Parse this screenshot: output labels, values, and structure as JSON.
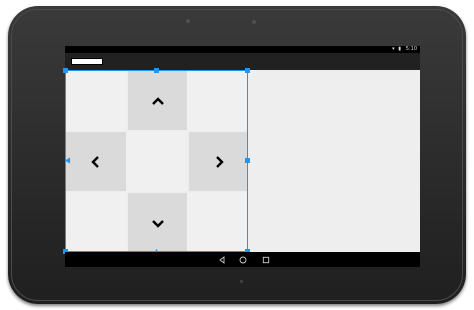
{
  "device": {
    "name": "Nexus 10"
  },
  "status_bar": {
    "time": "5:10",
    "icons": [
      "wifi-icon",
      "battery-icon"
    ]
  },
  "action_bar": {
    "title": ""
  },
  "dpad": {
    "up": {
      "icon": "chevron-up-icon"
    },
    "left": {
      "icon": "chevron-left-icon"
    },
    "right": {
      "icon": "chevron-right-icon"
    },
    "down": {
      "icon": "chevron-down-icon"
    }
  },
  "nav_bar": {
    "buttons": [
      "back-icon",
      "home-icon",
      "recents-icon"
    ]
  },
  "colors": {
    "selection": "#2196f3",
    "button_bg": "#dadada",
    "cell_bg": "#f0f0f0",
    "screen_bg": "#eeeeee",
    "action_bar": "#212121"
  }
}
